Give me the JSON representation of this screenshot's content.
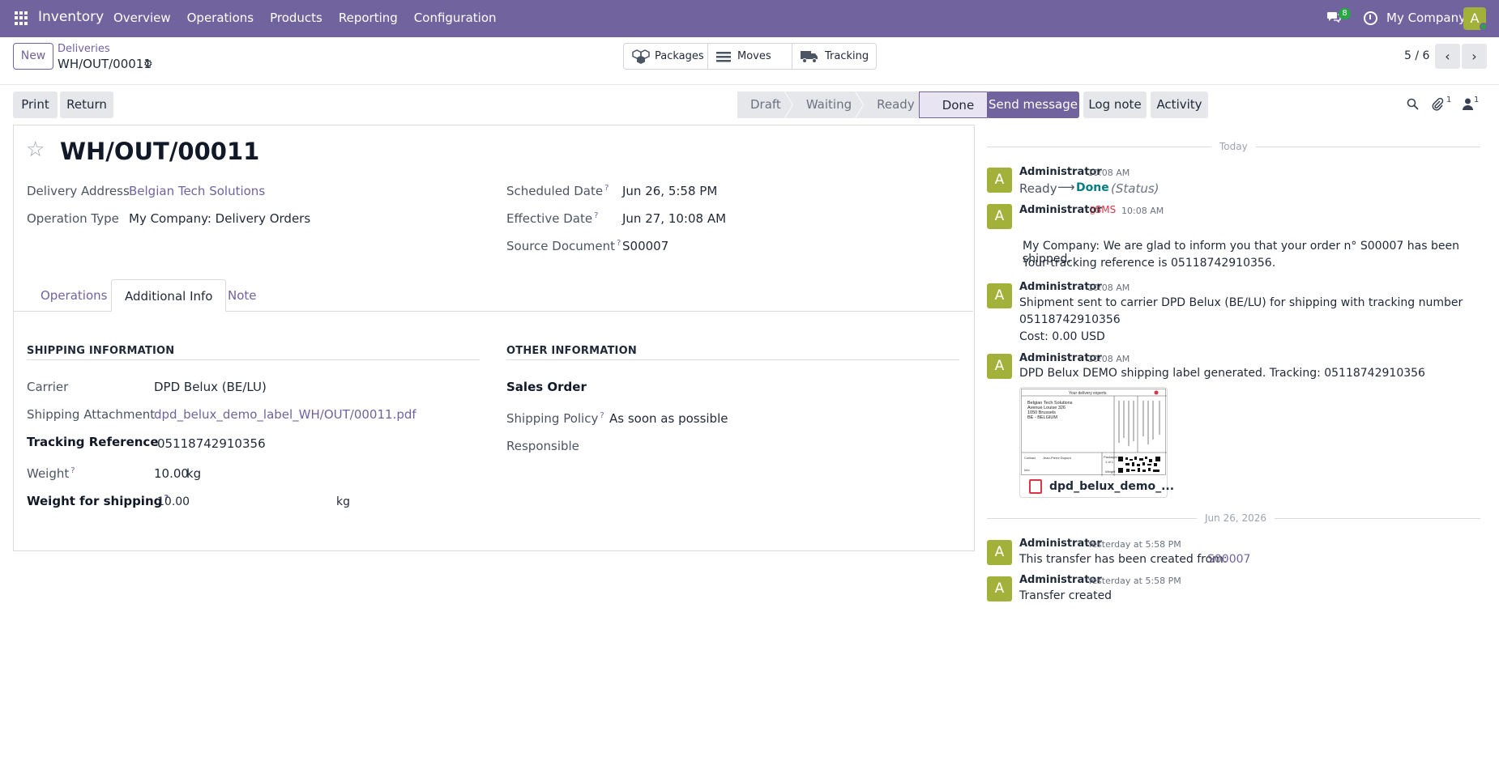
{
  "navbar": {
    "app_name": "Inventory",
    "menu": [
      "Overview",
      "Operations",
      "Products",
      "Reporting",
      "Configuration"
    ],
    "messages_badge": "8",
    "company": "My Company",
    "avatar_letter": "A",
    "bg_color": "#71639e"
  },
  "control_panel": {
    "new_label": "New",
    "breadcrumb_parent": "Deliveries",
    "breadcrumb_current": "WH/OUT/00011",
    "smart_buttons": [
      {
        "label": "Packages",
        "icon": "boxes-icon"
      },
      {
        "label": "Moves",
        "icon": "list-icon"
      },
      {
        "label": "Tracking",
        "icon": "truck-icon"
      }
    ],
    "pager": "5 / 6"
  },
  "actions": {
    "print": "Print",
    "return": "Return",
    "stages": [
      "Draft",
      "Waiting",
      "Ready",
      "Done"
    ],
    "active_stage": "Done"
  },
  "record": {
    "title": "WH/OUT/00011",
    "left_fields": [
      {
        "label": "Delivery Address",
        "value": "Belgian Tech Solutions"
      },
      {
        "label": "Operation Type",
        "value": "My Company: Delivery Orders"
      }
    ],
    "right_fields": [
      {
        "label": "Scheduled Date",
        "help": "?",
        "value": "Jun 26, 5:58 PM"
      },
      {
        "label": "Effective Date",
        "help": "?",
        "value": "Jun 27, 10:08 AM"
      },
      {
        "label": "Source Document",
        "help": "?",
        "value": "S00007"
      }
    ],
    "tabs": [
      "Operations",
      "Additional Info",
      "Note"
    ],
    "active_tab": "Additional Info"
  },
  "shipping": {
    "heading": "SHIPPING INFORMATION",
    "carrier_label": "Carrier",
    "carrier": "DPD Belux (BE/LU)",
    "attachment_label": "Shipping Attachment",
    "attachment": "dpd_belux_demo_label_WH/OUT/00011.pdf",
    "tracking_label": "Tracking Reference",
    "tracking": "05118742910356",
    "weight_label": "Weight",
    "weight": "10.00",
    "weight_unit": "kg",
    "ship_weight_label": "Weight for shipping",
    "ship_weight": "10.00",
    "ship_weight_unit": "kg"
  },
  "other": {
    "heading": "OTHER INFORMATION",
    "sales_order_label": "Sales Order",
    "policy_label": "Shipping Policy",
    "policy": "As soon as possible",
    "responsible_label": "Responsible"
  },
  "chatter": {
    "send_message": "Send message",
    "log_note": "Log note",
    "activity": "Activity",
    "attachments_count": "1",
    "followers_count": "1",
    "sep_today": "Today",
    "sep_date": "Jun 26, 2026",
    "messages": [
      {
        "author": "Administrator",
        "time": "10:08 AM",
        "from": "Ready",
        "to": "Done",
        "field": "(Status)"
      },
      {
        "author": "Administrator",
        "tag": "SMS",
        "time": "10:08 AM",
        "line1": "My Company: We are glad to inform you that your order n° S00007 has been shipped.",
        "line2": "Your tracking reference is 05118742910356."
      },
      {
        "author": "Administrator",
        "time": "10:08 AM",
        "line1": "Shipment sent to carrier DPD Belux (BE/LU) for shipping with tracking number",
        "line2": "05118742910356",
        "line3": "Cost: 0.00 USD"
      },
      {
        "author": "Administrator",
        "time": "10:08 AM",
        "line1": "DPD Belux DEMO shipping label generated. Tracking: 05118742910356",
        "attachment": "dpd_belux_demo_..."
      },
      {
        "author": "Administrator",
        "time": "Yesterday at 5:58 PM",
        "text": "This transfer has been created from:",
        "link": "S00007"
      },
      {
        "author": "Administrator",
        "time": "Yesterday at 5:58 PM",
        "text": "Transfer created"
      }
    ],
    "label_preview": {
      "header": "Your delivery experts",
      "address": [
        "Belgian Tech Solutions",
        "Avenue Louise 326",
        "1050 Brussels",
        "BE - BELGIUM"
      ],
      "contact": "Contact",
      "contact_name": "Jean-Pierre Dupont",
      "packages": "Packages",
      "packages_val": "1 of 1",
      "weight": "Weight",
      "info": "Info"
    }
  }
}
